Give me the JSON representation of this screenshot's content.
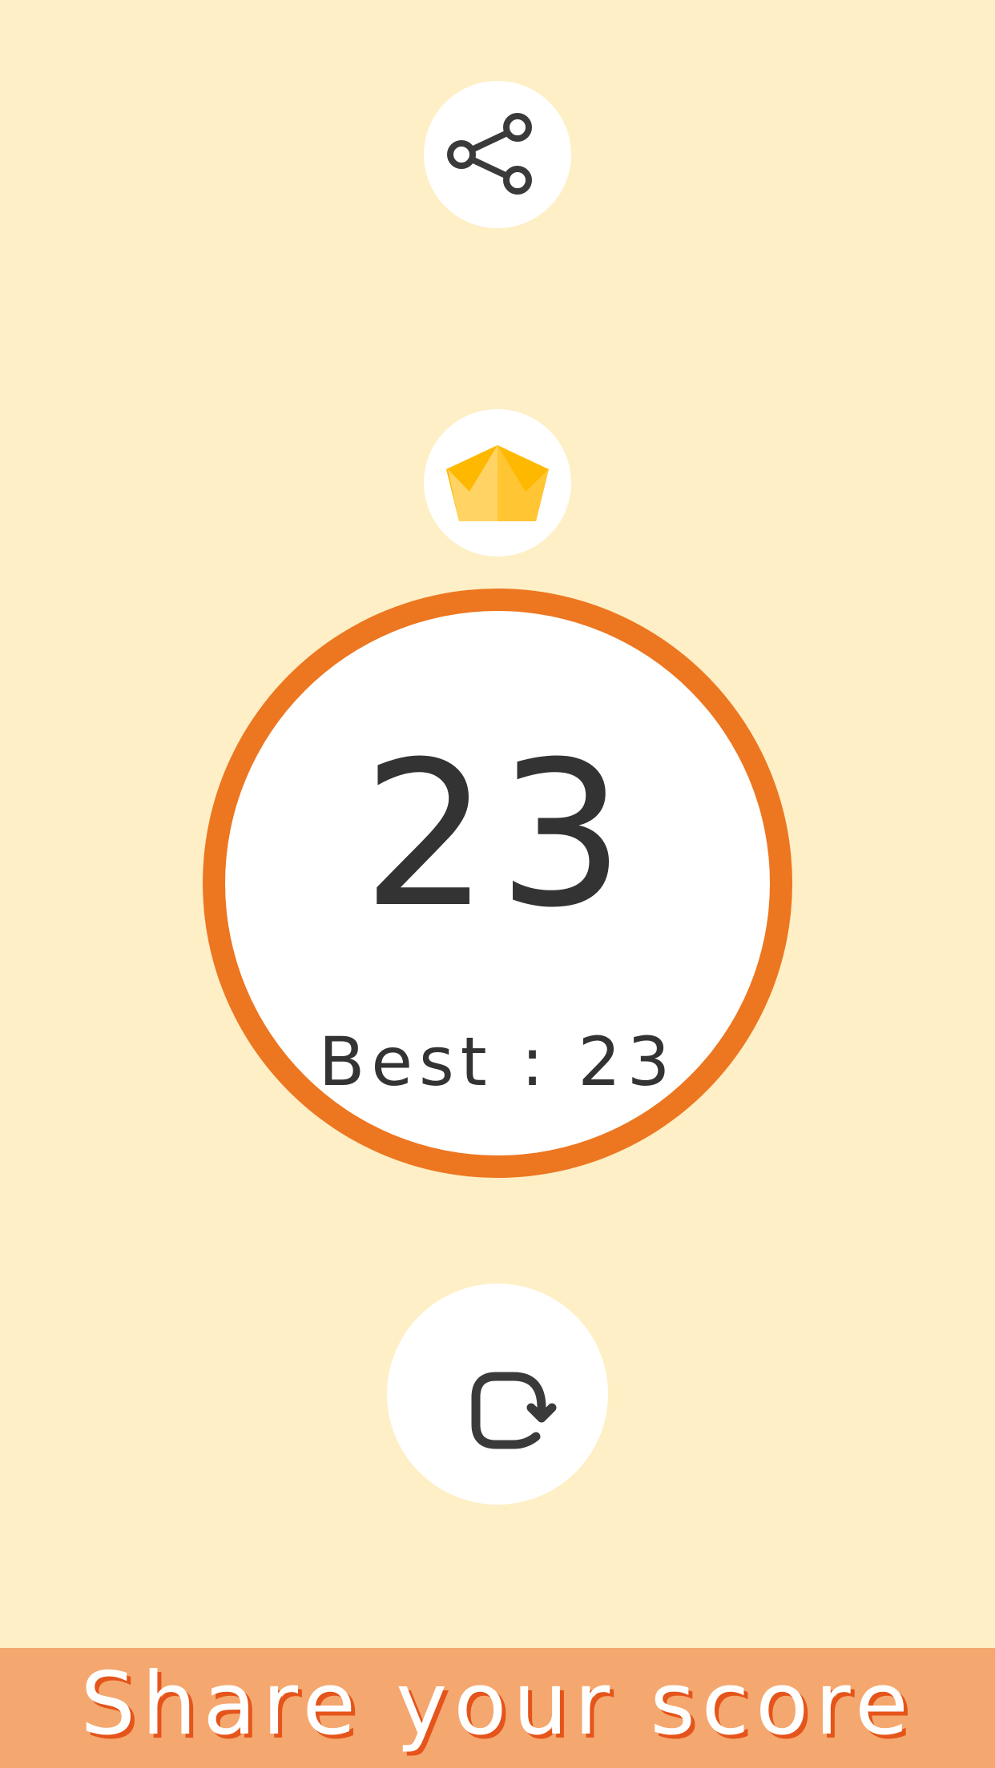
{
  "score": {
    "value": "23",
    "best_label": "Best : 23"
  },
  "banner": {
    "text": "Share your score"
  },
  "icons": {
    "share": "share-icon",
    "leaderboard": "crown-icon",
    "replay": "replay-icon"
  },
  "colors": {
    "background": "#FEEFC6",
    "ring": "#ED7620",
    "banner": "#F4A86F",
    "banner_text_shadow": "#E5541A",
    "icon_stroke": "#3A3A3A",
    "crown_gold": "#FFC533"
  }
}
